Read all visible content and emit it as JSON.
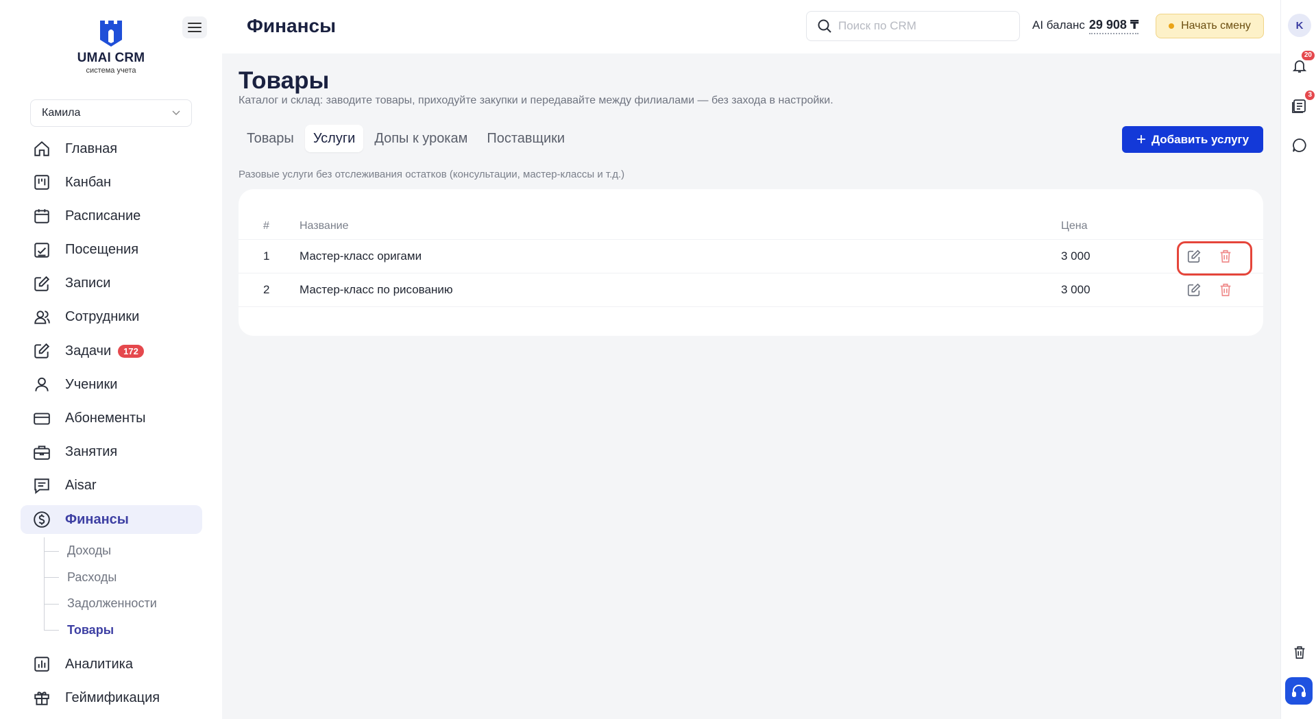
{
  "brand": {
    "name": "UMAI CRM",
    "tagline": "система учета"
  },
  "user_select": {
    "value": "Камила"
  },
  "nav": {
    "items": [
      {
        "label": "Главная",
        "icon": "home-icon"
      },
      {
        "label": "Канбан",
        "icon": "kanban-icon"
      },
      {
        "label": "Расписание",
        "icon": "calendar-icon"
      },
      {
        "label": "Посещения",
        "icon": "chart-check-icon"
      },
      {
        "label": "Записи",
        "icon": "edit-icon"
      },
      {
        "label": "Сотрудники",
        "icon": "users-icon"
      },
      {
        "label": "Задачи",
        "icon": "edit-icon",
        "badge": "172"
      },
      {
        "label": "Ученики",
        "icon": "user-icon"
      },
      {
        "label": "Абонементы",
        "icon": "card-icon"
      },
      {
        "label": "Занятия",
        "icon": "briefcase-icon"
      },
      {
        "label": "Aisar",
        "icon": "chat-list-icon"
      },
      {
        "label": "Финансы",
        "icon": "dollar-icon"
      }
    ],
    "finance_sub": [
      "Доходы",
      "Расходы",
      "Задолженности",
      "Товары"
    ],
    "bottom": [
      {
        "label": "Аналитика",
        "icon": "analytics-icon"
      },
      {
        "label": "Геймификация",
        "icon": "gift-icon"
      }
    ]
  },
  "header": {
    "title": "Финансы",
    "search_placeholder": "Поиск по CRM",
    "ai_balance_label": "AI баланс",
    "ai_balance_value": "29 908 ₸",
    "shift_button": "Начать смену"
  },
  "rail": {
    "avatar": "K",
    "notifications_badge": "20",
    "docs_badge": "3"
  },
  "page": {
    "title": "Товары",
    "subtitle": "Каталог и склад: заводите товары, приходуйте закупки и передавайте между филиалами — без захода в настройки.",
    "tabs": [
      "Товары",
      "Услуги",
      "Допы к урокам",
      "Поставщики"
    ],
    "active_tab": "Услуги",
    "add_button": "Добавить услугу",
    "hint": "Разовые услуги без отслеживания остатков (консультации, мастер-классы и т.д.)"
  },
  "table": {
    "headers": {
      "num": "#",
      "name": "Название",
      "price": "Цена"
    },
    "rows": [
      {
        "num": "1",
        "name": "Мастер-класс оригами",
        "price": "3 000"
      },
      {
        "num": "2",
        "name": "Мастер-класс по рисованию",
        "price": "3 000"
      }
    ]
  },
  "colors": {
    "accent": "#1339d8",
    "active_nav": "#3d3fa3",
    "danger": "#e5484d",
    "highlight": "#e5453a"
  }
}
